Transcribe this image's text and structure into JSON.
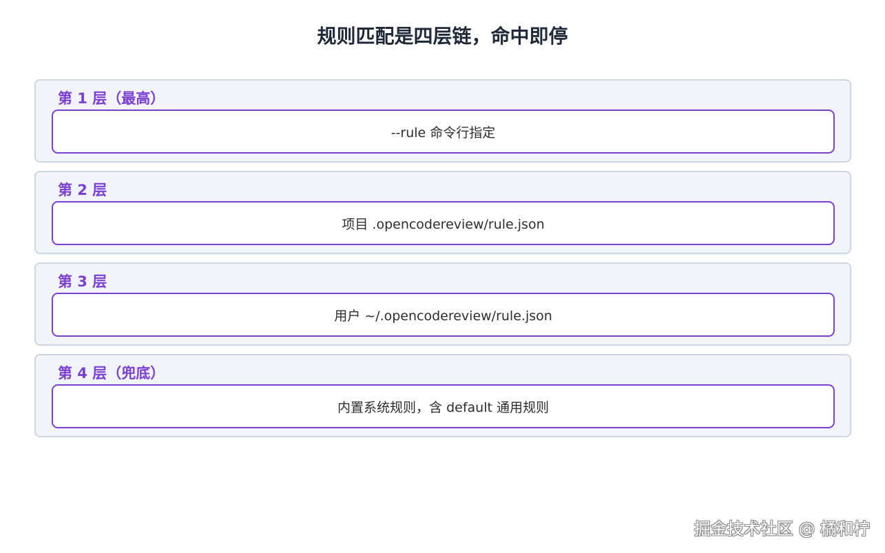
{
  "title": "规则匹配是四层链，命中即停",
  "layers": [
    {
      "label": "第 1 层（最高）",
      "text": "--rule 命令行指定"
    },
    {
      "label": "第 2 层",
      "text": "项目 .opencodereview/rule.json"
    },
    {
      "label": "第 3 层",
      "text": "用户 ~/.opencodereview/rule.json"
    },
    {
      "label": "第 4 层（兜底）",
      "text": "内置系统规则，含 default 通用规则"
    }
  ],
  "colors": {
    "accent": "#7b3fd6",
    "card_background": "#f1f4f8",
    "card_border": "#cfd6df",
    "title": "#1f2937"
  },
  "watermark": "掘金技术社区 @ 橘和柠"
}
